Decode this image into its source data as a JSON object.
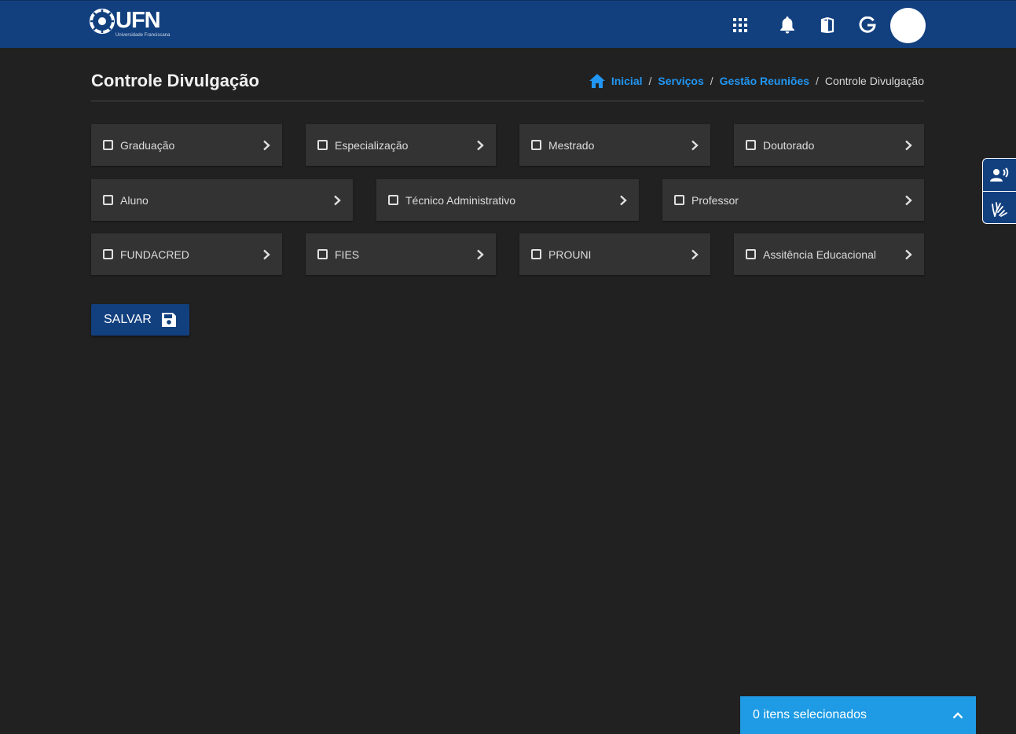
{
  "header": {
    "logo": {
      "name": "UFN",
      "subtitle": "Universidade Franciscana"
    },
    "icons": [
      "apps-grid-icon",
      "bell-icon",
      "book-icon",
      "google-icon"
    ]
  },
  "page": {
    "title": "Controle Divulgação",
    "breadcrumb": [
      "Inicial",
      "Serviços",
      "Gestão Reuniões",
      "Controle Divulgação"
    ]
  },
  "options": {
    "row1": [
      "Graduação",
      "Especialização",
      "Mestrado",
      "Doutorado"
    ],
    "row2": [
      "Aluno",
      "Técnico Administrativo",
      "Professor"
    ],
    "row3": [
      "FUNDACRED",
      "FIES",
      "PROUNI",
      "Assitência Educacional"
    ]
  },
  "save_label": "SALVAR",
  "selection_label": "0 itens selecionados",
  "colors": {
    "brand": "#12407f",
    "accent": "#1e9be4",
    "background": "#212121",
    "card": "#333333"
  }
}
